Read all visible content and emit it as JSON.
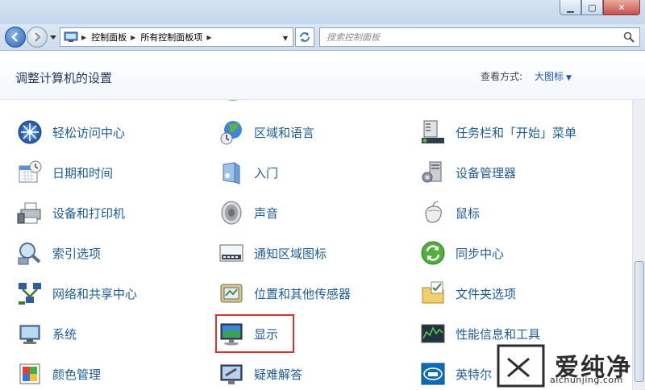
{
  "window": {
    "min_label": "▁",
    "max_label": "▢",
    "close_label": "✕"
  },
  "nav": {
    "breadcrumbs": [
      "控制面板",
      "所有控制面板项"
    ],
    "search_placeholder": "搜索控制面板"
  },
  "header": {
    "title": "调整计算机的设置",
    "view_by_label": "查看方式:",
    "view_by_value": "大图标"
  },
  "items": [
    {
      "label": "轻松访问中心",
      "icon": "ease-of-access-icon"
    },
    {
      "label": "区域和语言",
      "icon": "region-language-icon"
    },
    {
      "label": "任务栏和「开始」菜单",
      "icon": "taskbar-icon"
    },
    {
      "label": "日期和时间",
      "icon": "date-time-icon"
    },
    {
      "label": "入门",
      "icon": "getting-started-icon"
    },
    {
      "label": "设备管理器",
      "icon": "device-manager-icon"
    },
    {
      "label": "设备和打印机",
      "icon": "devices-printers-icon"
    },
    {
      "label": "声音",
      "icon": "sound-icon"
    },
    {
      "label": "鼠标",
      "icon": "mouse-icon"
    },
    {
      "label": "索引选项",
      "icon": "indexing-icon"
    },
    {
      "label": "通知区域图标",
      "icon": "notification-icons-icon"
    },
    {
      "label": "同步中心",
      "icon": "sync-center-icon"
    },
    {
      "label": "网络和共享中心",
      "icon": "network-sharing-icon"
    },
    {
      "label": "位置和其他传感器",
      "icon": "location-sensors-icon"
    },
    {
      "label": "文件夹选项",
      "icon": "folder-options-icon"
    },
    {
      "label": "系统",
      "icon": "system-icon"
    },
    {
      "label": "显示",
      "icon": "display-icon"
    },
    {
      "label": "性能信息和工具",
      "icon": "performance-icon"
    },
    {
      "label": "颜色管理",
      "icon": "color-management-icon"
    },
    {
      "label": "疑难解答",
      "icon": "troubleshooting-icon"
    },
    {
      "label": "英特尔",
      "icon": "intel-icon"
    }
  ],
  "highlighted_item": "显示",
  "watermark": {
    "text": "爱纯净",
    "url": "aichunjing.com"
  },
  "colors": {
    "link": "#1d5c96",
    "highlight_border": "#d9312b"
  }
}
